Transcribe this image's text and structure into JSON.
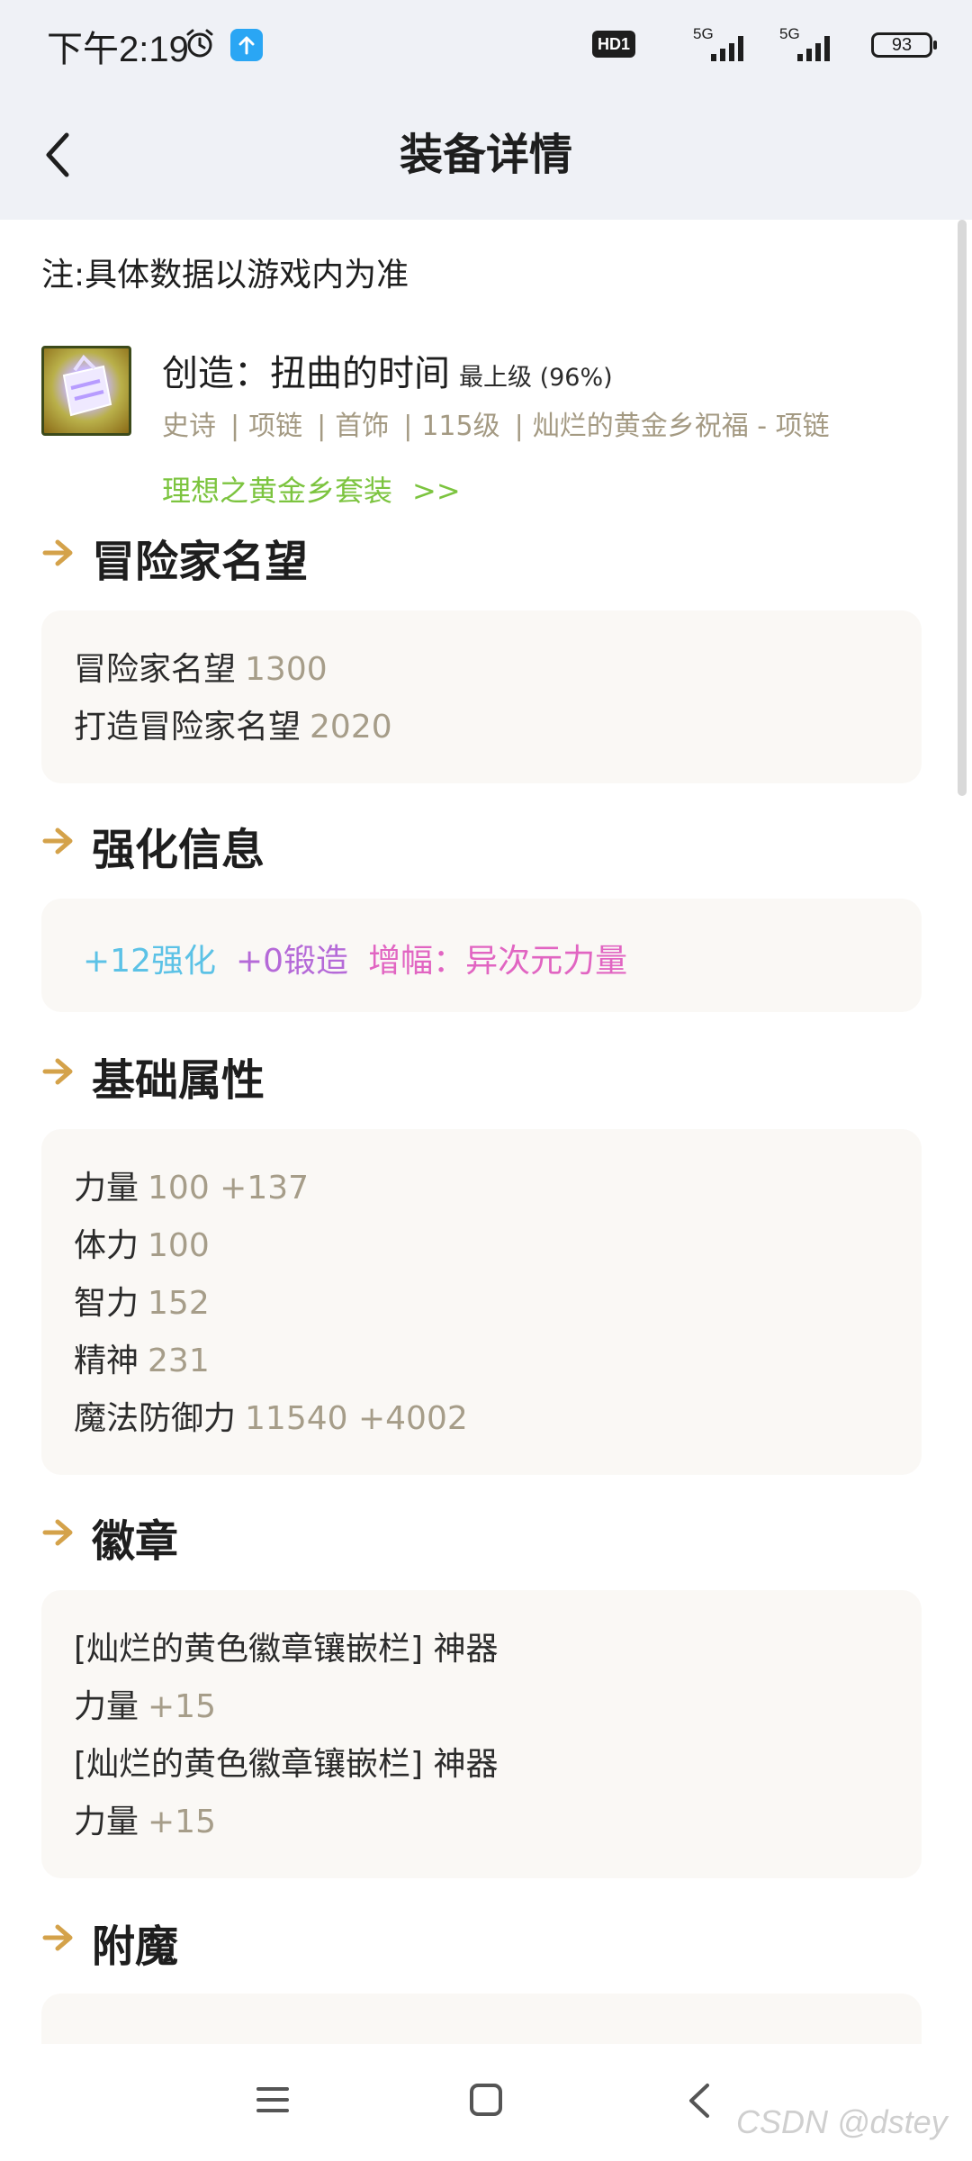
{
  "status_bar": {
    "time": "下午2:19",
    "hd_badge": "HD1",
    "signal1_label": "5G",
    "signal2_label": "5G",
    "battery": "93"
  },
  "header": {
    "title": "装备详情"
  },
  "note": "注:具体数据以游戏内为准",
  "item": {
    "name": "创造：扭曲的时间",
    "grade": "最上级 (96%)",
    "tags": [
      "史诗",
      "项链",
      "首饰",
      "115级",
      "灿烂的黄金乡祝福 - 项链"
    ],
    "set_link": "理想之黄金乡套装",
    "set_chevron": ">>"
  },
  "sections": {
    "reputation": {
      "title": "冒险家名望",
      "rows": [
        {
          "label": "冒险家名望",
          "value": "1300"
        },
        {
          "label": "打造冒险家名望",
          "value": "2020"
        }
      ]
    },
    "enhance": {
      "title": "强化信息",
      "plus": "+12强化",
      "forge": "+0锻造",
      "amp": "增幅：异次元力量"
    },
    "base": {
      "title": "基础属性",
      "rows": [
        {
          "label": "力量",
          "value": "100 +137"
        },
        {
          "label": "体力",
          "value": "100"
        },
        {
          "label": "智力",
          "value": "152"
        },
        {
          "label": "精神",
          "value": "231"
        },
        {
          "label": "魔法防御力",
          "value": "11540 +4002"
        }
      ]
    },
    "emblem": {
      "title": "徽章",
      "rows": [
        {
          "label": "[灿烂的黄色徽章镶嵌栏] 神器",
          "value": ""
        },
        {
          "label": "力量",
          "value": "+15"
        },
        {
          "label": "[灿烂的黄色徽章镶嵌栏] 神器",
          "value": ""
        },
        {
          "label": "力量",
          "value": "+15"
        }
      ]
    },
    "enchant": {
      "title": "附魔"
    }
  },
  "watermark": "CSDN @dstey",
  "colors": {
    "header_bg": "#eff1f6",
    "accent_gold": "#d4a24a",
    "value_gray": "#a69d89",
    "set_green": "#7cc43f",
    "enhance_cyan": "#5cc2e6",
    "forge_purple": "#b56ad8",
    "amp_pink": "#e165c2"
  }
}
